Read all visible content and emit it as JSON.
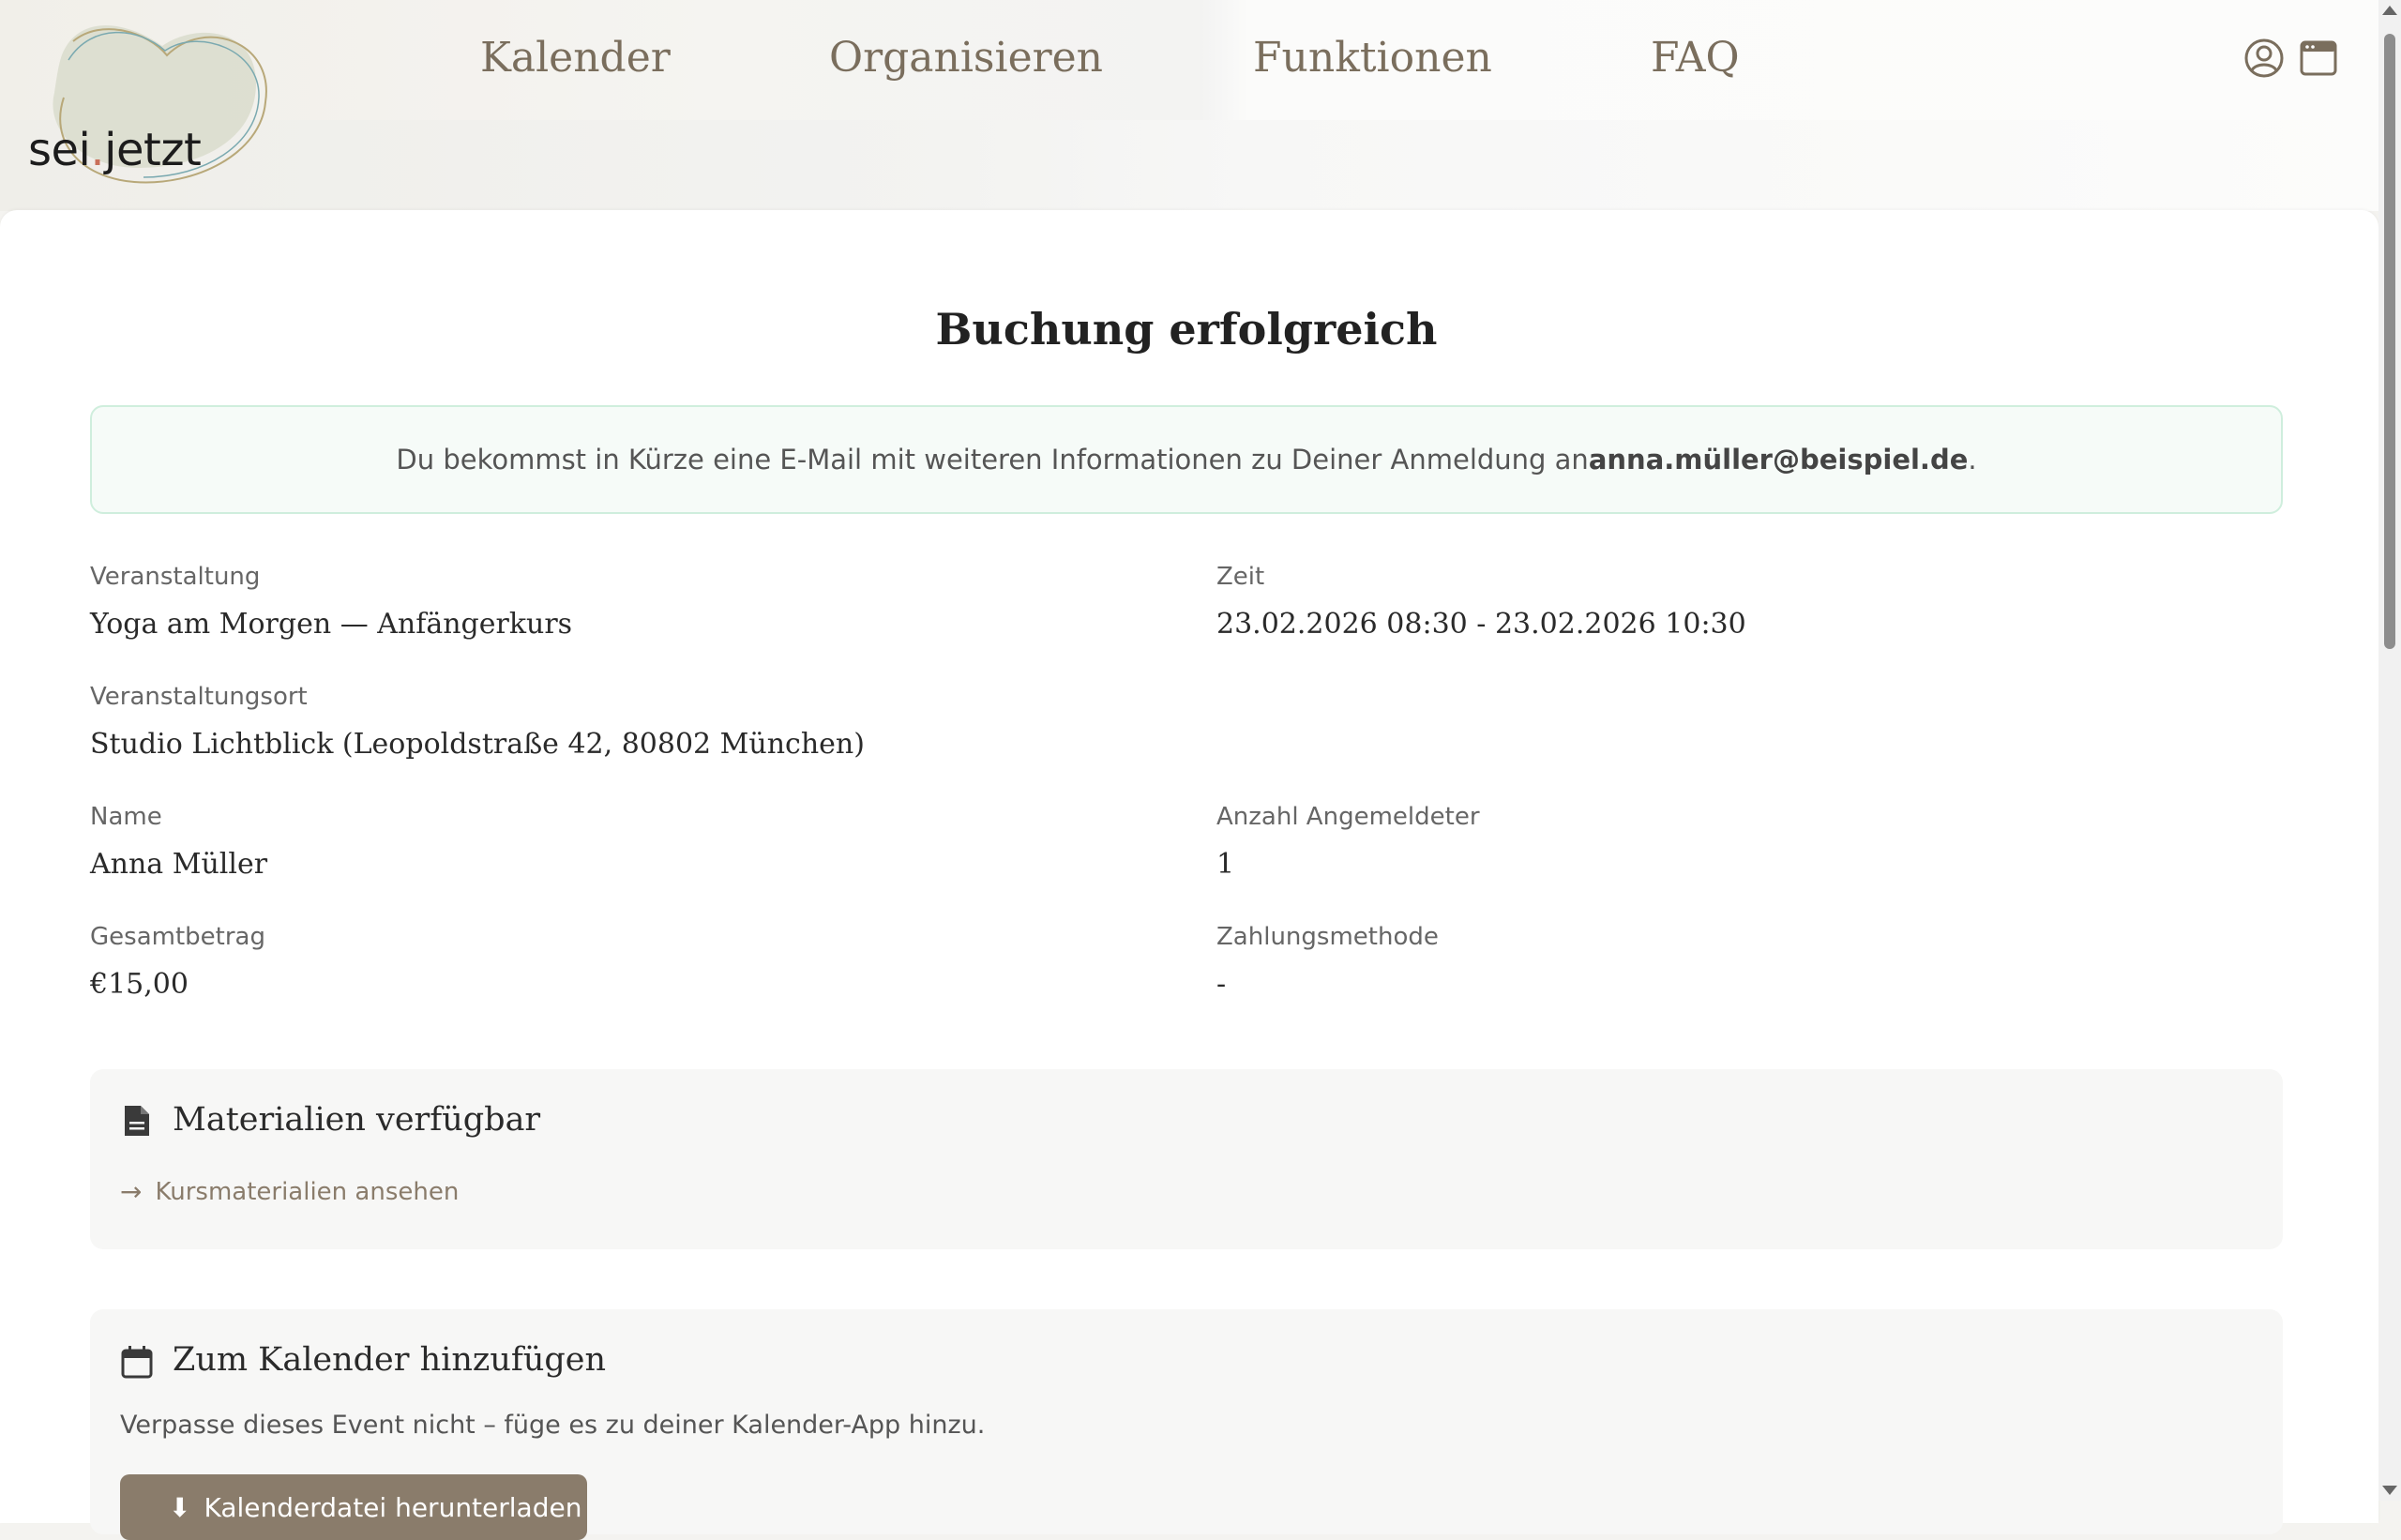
{
  "brand": {
    "name_part1": "sei",
    "name_dot": ".",
    "name_part2": "jetzt"
  },
  "nav": {
    "items": [
      {
        "label": "Kalender"
      },
      {
        "label": "Organisieren"
      },
      {
        "label": "Funktionen"
      },
      {
        "label": "FAQ"
      }
    ]
  },
  "header_icons": [
    "user-circle-icon",
    "browser-window-icon"
  ],
  "page": {
    "title": "Buchung erfolgreich",
    "notice_text": "Du bekommst in Kürze eine E-Mail mit weiteren Informationen zu Deiner Anmeldung an ",
    "notice_email": "anna.müller@beispiel.de",
    "notice_end": "."
  },
  "details": {
    "event_label": "Veranstaltung",
    "event_value": "Yoga am Morgen — Anfängerkurs",
    "time_label": "Zeit",
    "time_value": "23.02.2026 08:30 - 23.02.2026 10:30",
    "location_label": "Veranstaltungsort",
    "location_value": "Studio Lichtblick (Leopoldstraße 42, 80802 München)",
    "name_label": "Name",
    "name_value": "Anna Müller",
    "count_label": "Anzahl Angemeldeter",
    "count_value": "1",
    "total_label": "Gesamtbetrag",
    "total_value": "€15,00",
    "payment_label": "Zahlungsmethode",
    "payment_value": "-"
  },
  "materials": {
    "icon": "document-icon",
    "title": "Materialien verfügbar",
    "link_label": "Kursmaterialien ansehen"
  },
  "calendar": {
    "icon": "calendar-icon",
    "title": "Zum Kalender hinzufügen",
    "description": "Verpasse dieses Event nicht – füge es zu deiner Kalender-App hinzu.",
    "button_label": "Kalenderdatei herunterladen"
  },
  "colors": {
    "accent": "#8a7c6b",
    "nav_text": "#7a6e5d",
    "notice_bg": "#f6fbf8",
    "notice_border": "#cfeedd"
  }
}
